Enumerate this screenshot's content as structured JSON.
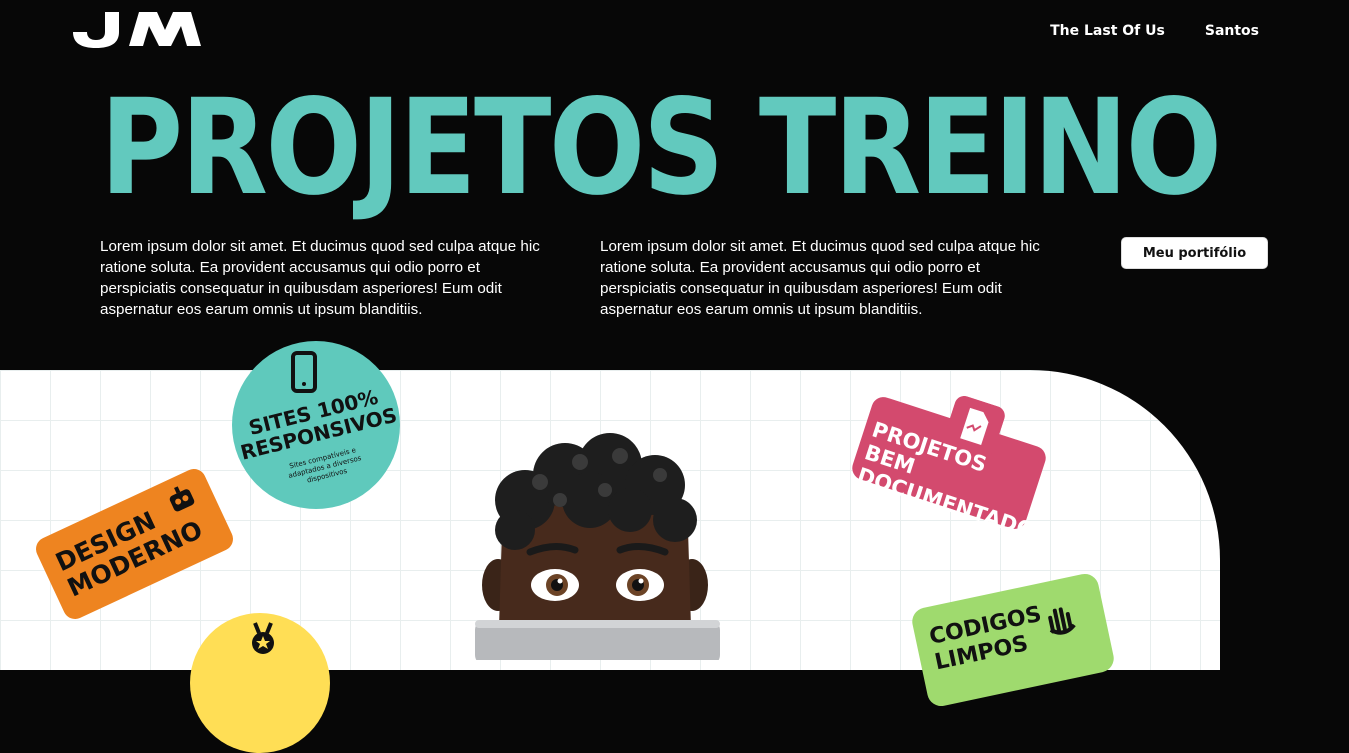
{
  "brand": {
    "logo_text": "JM"
  },
  "nav": {
    "items": [
      "The Last Of Us",
      "Santos"
    ]
  },
  "hero": {
    "title": "PROJETOS TREINO",
    "para1": "Lorem ipsum dolor sit amet. Et ducimus quod sed culpa atque hic ratione soluta. Ea provident accusamus qui odio porro et perspiciatis consequatur in quibusdam asperiores! Eum odit aspernatur eos earum omnis ut ipsum blanditiis.",
    "para2": "Lorem ipsum dolor sit amet. Et ducimus quod sed culpa atque hic ratione soluta. Ea provident accusamus qui odio porro et perspiciatis consequatur in quibusdam asperiores! Eum odit aspernatur eos earum omnis ut ipsum blanditiis.",
    "cta": "Meu portifólio"
  },
  "stickers": {
    "responsive_title": "SITES 100% RESPONSIVOS",
    "responsive_sub": "Sites compatíveis e adaptados a diversos dispositivos",
    "design": "DESIGN MODERNO",
    "docs": "PROJETOS BEM DOCUMENTADOS",
    "codes": "CODIGOS LIMPOS"
  },
  "colors": {
    "accent": "#62c9be",
    "background": "#070707",
    "pink": "#d34a6e",
    "orange": "#ee8420",
    "lime": "#9fda6e",
    "yellow": "#ffde55"
  }
}
